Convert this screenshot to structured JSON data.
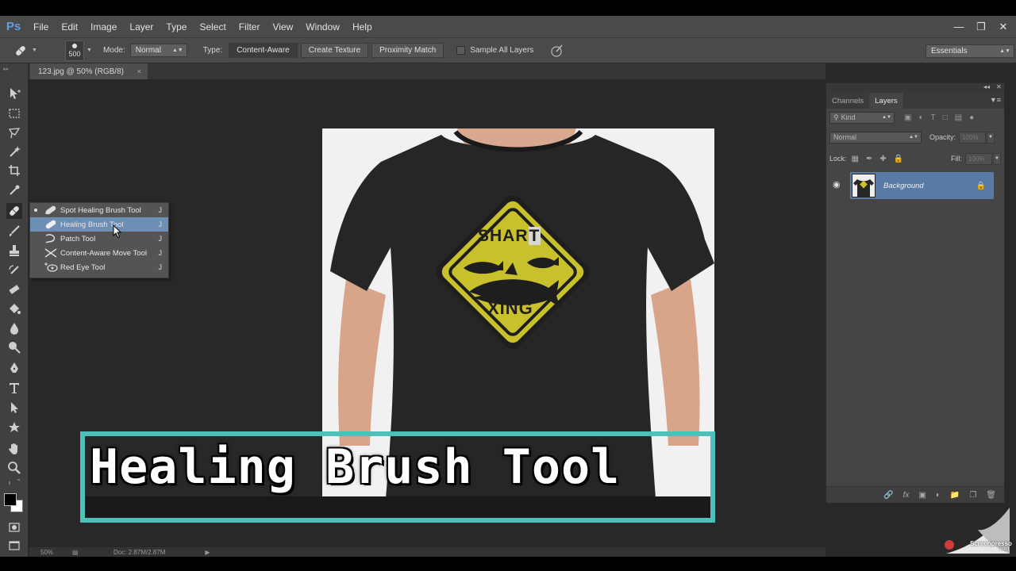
{
  "app": {
    "logo": "Ps",
    "menu": [
      "File",
      "Edit",
      "Image",
      "Layer",
      "Type",
      "Select",
      "Filter",
      "View",
      "Window",
      "Help"
    ]
  },
  "options": {
    "brush_size": "500",
    "mode_label": "Mode:",
    "mode_value": "Normal",
    "type_label": "Type:",
    "type_buttons": [
      "Content-Aware",
      "Create Texture",
      "Proximity Match"
    ],
    "sample_all_layers": "Sample All Layers",
    "workspace": "Essentials"
  },
  "document": {
    "tab_title": "123.jpg @ 50% (RGB/8)",
    "tab_close": "×",
    "sign_top": "SHAR",
    "sign_top_patch": "T",
    "sign_bottom": "XING"
  },
  "flyout": {
    "items": [
      {
        "label": "Spot Healing Brush Tool",
        "key": "J"
      },
      {
        "label": "Healing Brush Tool",
        "key": "J"
      },
      {
        "label": "Patch Tool",
        "key": "J"
      },
      {
        "label": "Content-Aware Move Tool",
        "key": "J"
      },
      {
        "label": "Red Eye Tool",
        "key": "J"
      }
    ]
  },
  "status": {
    "zoom": "50%",
    "doc": "Doc: 2.87M/2.87M"
  },
  "layers_panel": {
    "tabs": [
      "Channels",
      "Layers"
    ],
    "kind_filter": "Kind",
    "blend_mode": "Normal",
    "opacity_label": "Opacity:",
    "opacity_value": "100%",
    "lock_label": "Lock:",
    "fill_label": "Fill:",
    "fill_value": "100%",
    "layer_name": "Background"
  },
  "caption": {
    "text": "Healing Brush Tool"
  },
  "watermark": {
    "text": "Screenpresso",
    "sub": ".com"
  },
  "colors": {
    "caption_border": "#4fc0b8",
    "selection": "#6d8eb5",
    "sign_yellow": "#c9c12c",
    "shirt": "#262626"
  }
}
